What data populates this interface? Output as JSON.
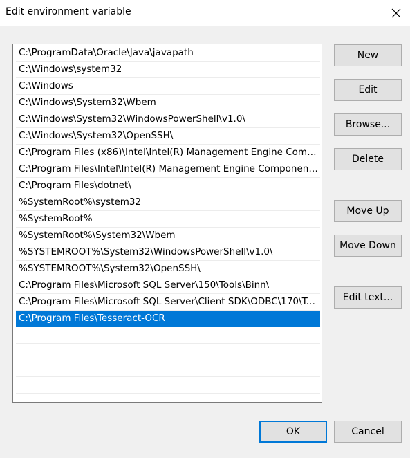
{
  "window": {
    "title": "Edit environment variable",
    "close_glyph": "✕"
  },
  "list": {
    "items": [
      {
        "text": "C:\\ProgramData\\Oracle\\Java\\javapath",
        "selected": false
      },
      {
        "text": "C:\\Windows\\system32",
        "selected": false
      },
      {
        "text": "C:\\Windows",
        "selected": false
      },
      {
        "text": "C:\\Windows\\System32\\Wbem",
        "selected": false
      },
      {
        "text": "C:\\Windows\\System32\\WindowsPowerShell\\v1.0\\",
        "selected": false
      },
      {
        "text": "C:\\Windows\\System32\\OpenSSH\\",
        "selected": false
      },
      {
        "text": "C:\\Program Files (x86)\\Intel\\Intel(R) Management Engine Comp...",
        "selected": false
      },
      {
        "text": "C:\\Program Files\\Intel\\Intel(R) Management Engine Components...",
        "selected": false
      },
      {
        "text": "C:\\Program Files\\dotnet\\",
        "selected": false
      },
      {
        "text": "%SystemRoot%\\system32",
        "selected": false
      },
      {
        "text": "%SystemRoot%",
        "selected": false
      },
      {
        "text": "%SystemRoot%\\System32\\Wbem",
        "selected": false
      },
      {
        "text": "%SYSTEMROOT%\\System32\\WindowsPowerShell\\v1.0\\",
        "selected": false
      },
      {
        "text": "%SYSTEMROOT%\\System32\\OpenSSH\\",
        "selected": false
      },
      {
        "text": "C:\\Program Files\\Microsoft SQL Server\\150\\Tools\\Binn\\",
        "selected": false
      },
      {
        "text": "C:\\Program Files\\Microsoft SQL Server\\Client SDK\\ODBC\\170\\To...",
        "selected": false
      },
      {
        "text": "C:\\Program Files\\Tesseract-OCR",
        "selected": true
      },
      {
        "text": "",
        "selected": false
      },
      {
        "text": "",
        "selected": false
      },
      {
        "text": "",
        "selected": false
      },
      {
        "text": "",
        "selected": false
      }
    ]
  },
  "buttons": {
    "new": "New",
    "edit": "Edit",
    "browse": "Browse...",
    "delete": "Delete",
    "move_up": "Move Up",
    "move_down": "Move Down",
    "edit_text": "Edit text...",
    "ok": "OK",
    "cancel": "Cancel"
  },
  "colors": {
    "selection": "#0078d7",
    "dialog_bg": "#f0f0f0",
    "button_bg": "#e1e1e1"
  }
}
